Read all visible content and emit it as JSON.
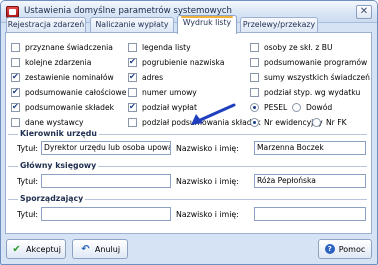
{
  "window": {
    "title": "Ustawienia domyślne parametrów systemowych",
    "close_glyph": "✕"
  },
  "tabs": [
    {
      "label": "Rejestracja zdarzeń"
    },
    {
      "label": "Naliczanie wypłaty"
    },
    {
      "label": "Wydruk listy"
    },
    {
      "label": "Przelewy/przekazy"
    }
  ],
  "options": {
    "col1": [
      {
        "label": "przyznane świadczenia",
        "checked": false
      },
      {
        "label": "kolejne zdarzenia",
        "checked": false
      },
      {
        "label": "zestawienie nominałów",
        "checked": true
      },
      {
        "label": "podsumowanie całościowe",
        "checked": true
      },
      {
        "label": "podsumowanie składek",
        "checked": true
      },
      {
        "label": "dane wystawcy",
        "checked": false
      }
    ],
    "col2": [
      {
        "label": "legenda listy",
        "checked": false
      },
      {
        "label": "pogrubienie nazwiska",
        "checked": true
      },
      {
        "label": "adres",
        "checked": true
      },
      {
        "label": "numer umowy",
        "checked": false
      },
      {
        "label": "podział wypłat",
        "checked": true
      },
      {
        "label": "podział podsumowania składek",
        "checked": false
      }
    ],
    "col3": [
      {
        "label": "osoby ze skł. z BU",
        "checked": false
      },
      {
        "label": "podsumowanie programów",
        "checked": false
      },
      {
        "label": "sumy wszystkich świadczeń",
        "checked": false
      },
      {
        "label": "podział styp. wg wydatku",
        "checked": false
      }
    ],
    "radio_pesel": {
      "label": "PESEL",
      "selected": true
    },
    "radio_dowod": {
      "label": "Dowód",
      "selected": false
    },
    "radio_nr_ewid": {
      "label": "Nr ewidencyjny",
      "selected": true
    },
    "radio_nr_fk": {
      "label": "Nr FK",
      "selected": false
    }
  },
  "kierownik": {
    "title": "Kierownik urzędu",
    "tytul_label": "Tytuł:",
    "tytul_value": "Dyrektor urzędu lub osoba upoważniona",
    "nazwisko_label": "Nazwisko i imię:",
    "nazwisko_value": "Marzenna Boczek"
  },
  "ksiegowy": {
    "title": "Główny księgowy",
    "tytul_label": "Tytuł:",
    "tytul_value": "",
    "nazwisko_label": "Nazwisko i imię:",
    "nazwisko_value": "Róża Pepłońska"
  },
  "sporzadzajacy": {
    "title": "Sporządzający",
    "tytul_label": "Tytuł:",
    "tytul_value": "",
    "nazwisko_label": "Nazwisko i imię:",
    "nazwisko_value": ""
  },
  "buttons": {
    "ok": "Akceptuj",
    "cancel": "Anuluj",
    "help": "Pomoc"
  },
  "colors": {
    "tab_accent": "#f1b23c",
    "arrow": "#1f3fbf",
    "check": "#1a3a8a"
  }
}
